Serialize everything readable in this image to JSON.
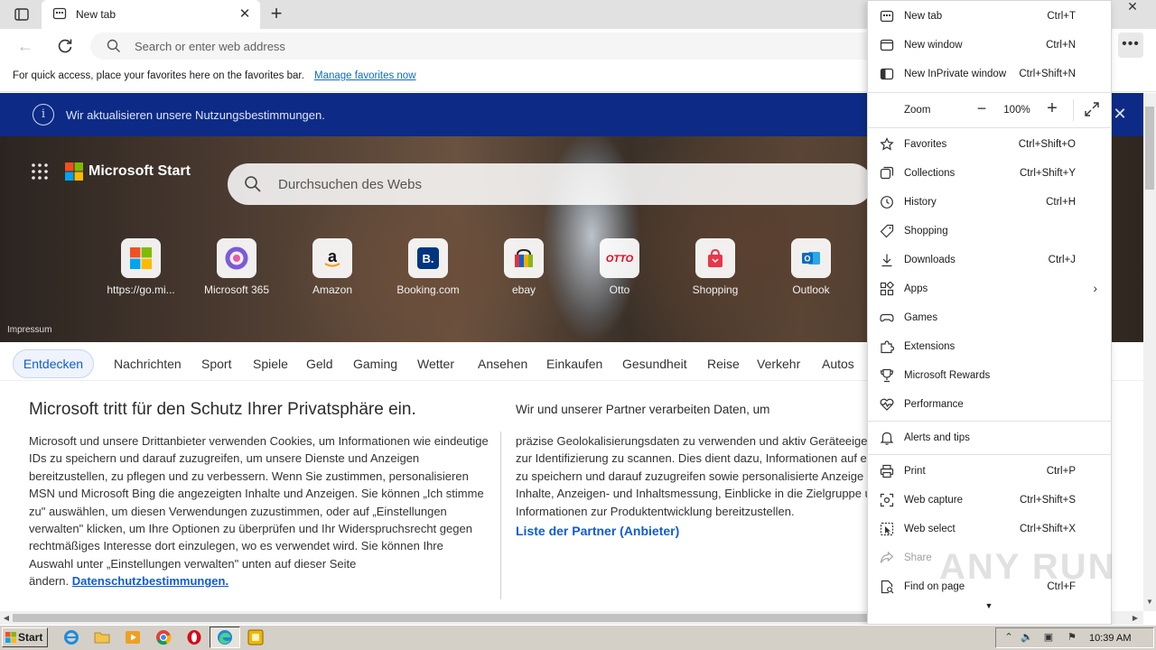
{
  "browser": {
    "tab_title": "New tab",
    "address_placeholder": "Search or enter web address",
    "favorites_bar_text": "For quick access, place your favorites here on the favorites bar.",
    "favorites_bar_link": "Manage favorites now"
  },
  "banner": {
    "info_icon": "i",
    "text": "Wir aktualisieren unsere Nutzungsbestimmungen."
  },
  "start_page": {
    "brand": "Microsoft Start",
    "search_placeholder": "Durchsuchen des Webs",
    "impressum": "Impressum",
    "tiles": [
      {
        "label": "https://go.mi...",
        "icon": "microsoft-logo"
      },
      {
        "label": "Microsoft 365",
        "icon": "m365-icon"
      },
      {
        "label": "Amazon",
        "icon": "amazon-icon"
      },
      {
        "label": "Booking.com",
        "icon": "booking-icon"
      },
      {
        "label": "ebay",
        "icon": "ebay-icon"
      },
      {
        "label": "Otto",
        "icon": "otto-icon"
      },
      {
        "label": "Shopping",
        "icon": "shopping-icon"
      },
      {
        "label": "Outlook",
        "icon": "outlook-icon"
      }
    ],
    "categories": [
      "Entdecken",
      "Nachrichten",
      "Sport",
      "Spiele",
      "Geld",
      "Gaming",
      "Wetter",
      "Ansehen",
      "Einkaufen",
      "Gesundheit",
      "Reise",
      "Verkehr",
      "Autos"
    ]
  },
  "consent": {
    "title": "Microsoft tritt für den Schutz Ihrer Privatsphäre ein.",
    "body": "Microsoft und unsere Drittanbieter verwenden Cookies, um Informationen wie eindeutige IDs zu speichern und darauf zuzugreifen, um unsere Dienste und Anzeigen bereitzustellen, zu pflegen und zu verbessern. Wenn Sie zustimmen, personalisieren MSN und Microsoft Bing die angezeigten Inhalte und Anzeigen. Sie können „Ich stimme zu\" auswählen, um diesen Verwendungen zuzustimmen, oder auf „Einstellungen verwalten\" klicken, um Ihre Optionen zu überprüfen und Ihr Widerspruchsrecht gegen rechtmäßiges Interesse dort einzulegen, wo es verwendet wird.  Sie können Ihre Auswahl unter „Einstellungen verwalten\" unten auf dieser Seite ändern.",
    "privacy_link": "Datenschutzbestimmungen.",
    "partner_title": "Wir und unserer Partner verarbeiten Daten, um",
    "partner_lines": [
      "präzise Geolokalisierungsdaten zu verwenden und aktiv Geräteeige",
      "zur Identifizierung zu scannen. Dies dient dazu, Informationen auf e",
      "zu speichern und darauf zuzugreifen sowie personalisierte Anzeige",
      "Inhalte, Anzeigen- und Inhaltsmessung, Einblicke in die Zielgruppe u",
      "Informationen zur Produktentwicklung bereitzustellen."
    ],
    "partner_link": "Liste der Partner (Anbieter)"
  },
  "menu": {
    "new_tab": {
      "label": "New tab",
      "shortcut": "Ctrl+T"
    },
    "new_window": {
      "label": "New window",
      "shortcut": "Ctrl+N"
    },
    "new_inprivate": {
      "label": "New InPrivate window",
      "shortcut": "Ctrl+Shift+N"
    },
    "zoom": {
      "label": "Zoom",
      "value": "100%"
    },
    "favorites": {
      "label": "Favorites",
      "shortcut": "Ctrl+Shift+O"
    },
    "collections": {
      "label": "Collections",
      "shortcut": "Ctrl+Shift+Y"
    },
    "history": {
      "label": "History",
      "shortcut": "Ctrl+H"
    },
    "shopping": {
      "label": "Shopping",
      "shortcut": ""
    },
    "downloads": {
      "label": "Downloads",
      "shortcut": "Ctrl+J"
    },
    "apps": {
      "label": "Apps",
      "shortcut": ""
    },
    "games": {
      "label": "Games",
      "shortcut": ""
    },
    "extensions": {
      "label": "Extensions",
      "shortcut": ""
    },
    "rewards": {
      "label": "Microsoft Rewards",
      "shortcut": ""
    },
    "performance": {
      "label": "Performance",
      "shortcut": ""
    },
    "alerts": {
      "label": "Alerts and tips",
      "shortcut": ""
    },
    "print": {
      "label": "Print",
      "shortcut": "Ctrl+P"
    },
    "web_capture": {
      "label": "Web capture",
      "shortcut": "Ctrl+Shift+S"
    },
    "web_select": {
      "label": "Web select",
      "shortcut": "Ctrl+Shift+X"
    },
    "share": {
      "label": "Share",
      "shortcut": ""
    },
    "find": {
      "label": "Find on page",
      "shortcut": "Ctrl+F"
    }
  },
  "watermark": "ANY RUN",
  "taskbar": {
    "start_label": "Start",
    "clock": "10:39 AM"
  },
  "colors": {
    "banner_bg": "#0d2b86",
    "accent_link": "#0f6cbd",
    "category_active": "#0f5bd6"
  }
}
